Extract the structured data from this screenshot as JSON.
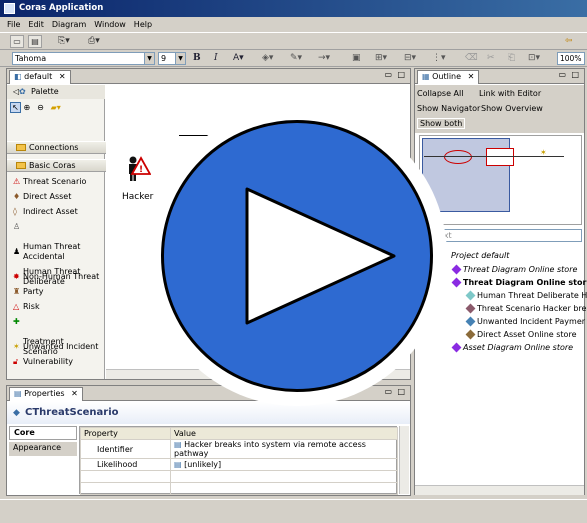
{
  "window": {
    "title": "Coras Application"
  },
  "menu": [
    "File",
    "Edit",
    "Diagram",
    "Window",
    "Help"
  ],
  "toolbar": {
    "font_name": "Tahoma",
    "font_size": "9",
    "bold": "B",
    "italic": "I",
    "zoom": "100%"
  },
  "editor": {
    "tab_label": "default",
    "palette_label": "Palette",
    "canvas_hacker_label": "Hacker"
  },
  "palette": {
    "drawers": [
      "Connections",
      "Basic Coras"
    ],
    "items": [
      {
        "label": "Threat Scenario",
        "icon": "threat-scenario-icon"
      },
      {
        "label": "Direct Asset",
        "icon": "direct-asset-icon"
      },
      {
        "label": "Indirect Asset",
        "icon": "indirect-asset-icon"
      },
      {
        "label": "Human Threat\nAccidental",
        "icon": "human-threat-accidental-icon"
      },
      {
        "label": "Human Threat\nDeliberate",
        "icon": "human-threat-deliberate-icon"
      },
      {
        "label": "Non-Human Threat",
        "icon": "non-human-threat-icon"
      },
      {
        "label": "Party",
        "icon": "party-icon"
      },
      {
        "label": "Risk",
        "icon": "risk-icon"
      },
      {
        "label": "Treatment\nScenario",
        "icon": "treatment-scenario-icon"
      },
      {
        "label": "Unwanted Incident",
        "icon": "unwanted-incident-icon"
      },
      {
        "label": "Vulnerability",
        "icon": "vulnerability-icon"
      }
    ]
  },
  "outline": {
    "tab_label": "Outline",
    "links": [
      "Collapse All",
      "Link with Editor",
      "Show Navigator",
      "Show Overview",
      "Show both"
    ],
    "filter_placeholder": "ter text",
    "tree": [
      {
        "label": "Project default",
        "level": 0,
        "italic": true
      },
      {
        "label": "Threat Diagram Online store",
        "level": 1,
        "italic": true
      },
      {
        "label": "Threat Diagram Online stor",
        "level": 1,
        "bold": true
      },
      {
        "label": "Human Threat Deliberate H",
        "level": 2
      },
      {
        "label": "Threat Scenario Hacker bre",
        "level": 2
      },
      {
        "label": "Unwanted Incident Paymer",
        "level": 2
      },
      {
        "label": "Direct Asset Online store",
        "level": 2
      },
      {
        "label": "Asset Diagram Online store",
        "level": 1,
        "italic": true
      }
    ]
  },
  "properties": {
    "tab_label": "Properties",
    "title": "CThreatScenario",
    "sections": [
      "Core",
      "Appearance"
    ],
    "headers": [
      "Property",
      "Value"
    ],
    "rows": [
      {
        "property": "Identifier",
        "value": "Hacker breaks into system via remote access pathway"
      },
      {
        "property": "Likelihood",
        "value": "[unlikely]"
      }
    ]
  },
  "colors": {
    "overlay_blue": "#2e6ad1",
    "title_start": "#0a246a",
    "title_end": "#3a6ea5"
  }
}
